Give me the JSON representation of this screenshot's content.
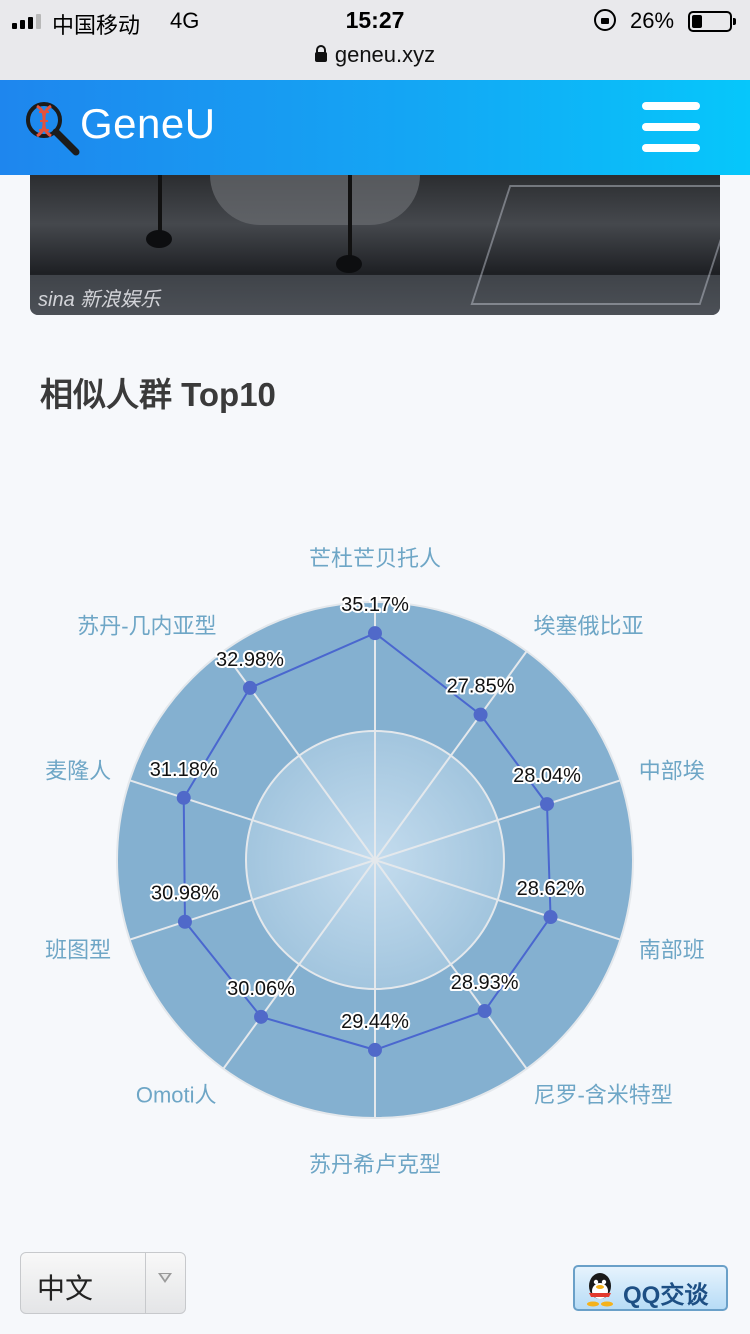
{
  "status_bar": {
    "carrier": "中国移动",
    "network": "4G",
    "time": "15:27",
    "battery_percent": "26%",
    "battery_level": 0.26,
    "url": "geneu.xyz"
  },
  "header": {
    "brand": "GeneU",
    "logo_icon": "dna-magnifier-icon",
    "menu_icon": "hamburger-menu-icon"
  },
  "photo": {
    "watermark": "sina 新浪娱乐"
  },
  "section": {
    "title": "相似人群 Top10"
  },
  "chart_data": {
    "type": "radar",
    "title": "",
    "max": 40,
    "rings": 2,
    "indicators": [
      "芒杜芒贝托人",
      "埃塞俄比亚",
      "中部埃",
      "南部班",
      "尼罗-含米特型",
      "苏丹希卢克型",
      "Omoti人",
      "班图型",
      "麦隆人",
      "苏丹-几内亚型"
    ],
    "values": [
      35.17,
      27.85,
      28.04,
      28.62,
      28.93,
      29.44,
      30.06,
      30.98,
      31.18,
      32.98
    ],
    "value_labels": [
      "35.17%",
      "27.85%",
      "28.04%",
      "28.62%",
      "28.93%",
      "29.44%",
      "30.06%",
      "30.98%",
      "31.18%",
      "32.98%"
    ],
    "colors": {
      "outer_ring": "#84b0d0",
      "inner_ring": "#a2c5de",
      "line": "#4a67cf",
      "point": "#5069c9"
    }
  },
  "footer": {
    "language_selected": "中文",
    "qq_button": "QQ交谈"
  }
}
